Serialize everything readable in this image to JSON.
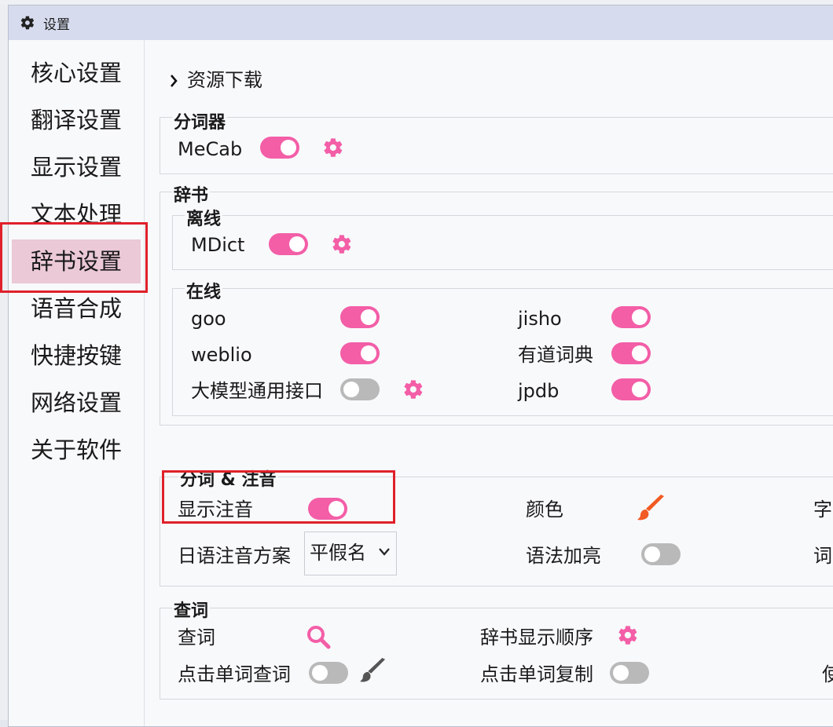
{
  "window": {
    "title": "设置"
  },
  "sidebar": {
    "items": [
      {
        "label": "核心设置"
      },
      {
        "label": "翻译设置"
      },
      {
        "label": "显示设置"
      },
      {
        "label": "文本处理"
      },
      {
        "label": "辞书设置"
      },
      {
        "label": "语音合成"
      },
      {
        "label": "快捷按键"
      },
      {
        "label": "网络设置"
      },
      {
        "label": "关于软件"
      }
    ],
    "active_index": 4
  },
  "resource_download": {
    "label": "资源下载"
  },
  "tokenizer": {
    "title": "分词器",
    "mecab": {
      "label": "MeCab",
      "enabled": true
    }
  },
  "dictionary": {
    "title": "辞书",
    "offline": {
      "title": "离线",
      "mdict": {
        "label": "MDict",
        "enabled": true
      }
    },
    "online": {
      "title": "在线",
      "goo": {
        "label": "goo",
        "enabled": true
      },
      "jisho": {
        "label": "jisho",
        "enabled": true
      },
      "weblio": {
        "label": "weblio",
        "enabled": true
      },
      "youdao": {
        "label": "有道词典",
        "enabled": true
      },
      "llm": {
        "label": "大模型通用接口",
        "enabled": false
      },
      "jpdb": {
        "label": "jpdb",
        "enabled": true
      }
    }
  },
  "segmentation": {
    "title": "分词 & 注音",
    "show_furigana": {
      "label": "显示注音",
      "enabled": true
    },
    "color": {
      "label": "颜色"
    },
    "furigana_scheme": {
      "label": "日语注音方案",
      "value": "平假名"
    },
    "grammar_highlight": {
      "label": "语法加亮",
      "enabled": false
    },
    "cut_right_1": "字",
    "cut_right_2": "词"
  },
  "lookup": {
    "title": "查词",
    "lookup_label": "查词",
    "dict_order": {
      "label": "辞书显示顺序"
    },
    "click_word_lookup": {
      "label": "点击单词查词",
      "enabled": false
    },
    "click_word_copy": {
      "label": "点击单词复制",
      "enabled": false
    },
    "cut_right": "使"
  },
  "colors": {
    "accent": "#f35ea7",
    "brush_color": "#f15a22",
    "highlight_box": "#e0202a"
  }
}
